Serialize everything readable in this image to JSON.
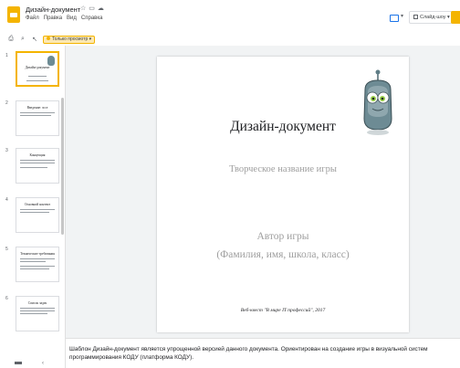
{
  "window": {
    "doc_title": "Дизайн-документ",
    "menu": [
      "Файл",
      "Правка",
      "Вид",
      "Справка"
    ],
    "slideshow_label": "Слайд-шоу",
    "toolbar_mode_label": "Только просмотр"
  },
  "filmstrip": {
    "thumbs": [
      {
        "num": "1",
        "title": "Дизайн-документ",
        "active": true
      },
      {
        "num": "2",
        "title": "Введение: эссе",
        "active": false
      },
      {
        "num": "3",
        "title": "Концепция",
        "active": false
      },
      {
        "num": "4",
        "title": "Основной контент",
        "active": false
      },
      {
        "num": "5",
        "title": "Технические требования",
        "active": false
      },
      {
        "num": "6",
        "title": "Список задач",
        "active": false
      }
    ]
  },
  "slide": {
    "title": "Дизайн-документ",
    "subtitle": "Творческое название игры",
    "author_line1": "Автор игры",
    "author_line2": "(Фамилия, имя, школа, класс)",
    "footer": "Веб-квест \"В мире IT профессий\", 2017"
  },
  "notes": {
    "line1": "Шаблон Дизайн-документ является упрощенной версией данного документа. Ориентирован на создание игры в визуальной систем",
    "line2": "программирования КОДУ (платформа КОДУ)."
  },
  "colors": {
    "accent": "#f4b400",
    "blue": "#1a73e8",
    "canvas_bg": "#f1f3f4",
    "robot_body": "#6d8b94"
  },
  "icons": [
    "print-icon",
    "zoom-icon",
    "cursor-icon",
    "star-icon",
    "folder-icon",
    "cloud-icon",
    "present-icon",
    "slideshow-icon"
  ]
}
